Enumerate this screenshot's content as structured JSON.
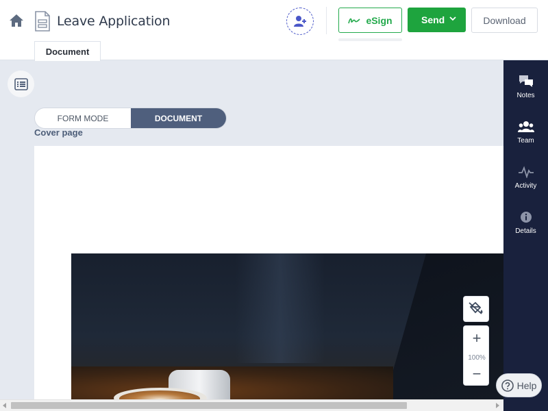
{
  "header": {
    "title": "Leave Application",
    "esign_label": "eSign",
    "send_label": "Send",
    "download_label": "Download",
    "tab_document": "Document"
  },
  "mode_toggle": {
    "form_mode": "FORM MODE",
    "document": "DOCUMENT",
    "active": "document"
  },
  "document": {
    "section_label": "Cover page"
  },
  "zoom": {
    "level": "100%"
  },
  "sidebar": {
    "items": [
      {
        "label": "Notes",
        "icon": "notes-icon"
      },
      {
        "label": "Team",
        "icon": "team-icon"
      },
      {
        "label": "Activity",
        "icon": "activity-icon"
      },
      {
        "label": "Details",
        "icon": "details-icon"
      }
    ]
  },
  "help": {
    "label": "Help"
  },
  "colors": {
    "send_green": "#1ea43e",
    "esign_green": "#22a94b",
    "sidebar_navy": "#19213d",
    "toggle_active": "#4f5f7d",
    "canvas_bg": "#e5e9f0"
  }
}
